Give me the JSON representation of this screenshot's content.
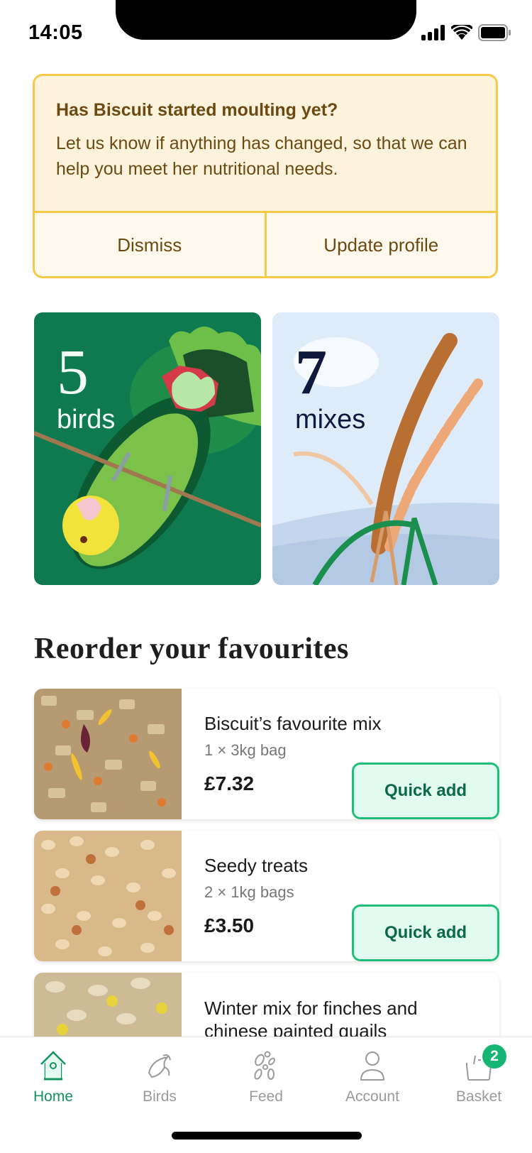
{
  "status_bar": {
    "time": "14:05"
  },
  "alert": {
    "title": "Has Biscuit started moulting yet?",
    "text": "Let us know if anything has changed, so that we can help you meet her nutritional needs.",
    "actions": {
      "dismiss": "Dismiss",
      "update": "Update profile"
    }
  },
  "tiles": {
    "birds": {
      "number": "5",
      "label": "birds"
    },
    "mixes": {
      "number": "7",
      "label": "mixes"
    }
  },
  "favourites": {
    "title": "Reorder your favourites",
    "items": [
      {
        "name": "Biscuit’s favourite mix",
        "qty": "1 × 3kg bag",
        "price": "£7.32",
        "action": "Quick add"
      },
      {
        "name": "Seedy treats",
        "qty": "2 × 1kg bags",
        "price": "£3.50",
        "action": "Quick add"
      },
      {
        "name": "Winter mix for finches and chinese painted quails"
      }
    ]
  },
  "tab_bar": {
    "tabs": [
      {
        "label": "Home",
        "icon": "birdhouse-icon",
        "active": true
      },
      {
        "label": "Birds",
        "icon": "bird-icon"
      },
      {
        "label": "Feed",
        "icon": "seeds-icon"
      },
      {
        "label": "Account",
        "icon": "person-icon"
      },
      {
        "label": "Basket",
        "icon": "basket-icon",
        "badge": "2"
      }
    ]
  },
  "colors": {
    "accent": "#14935e",
    "alert_border": "#f7c948",
    "quick_add_border": "#1fbf7a"
  }
}
